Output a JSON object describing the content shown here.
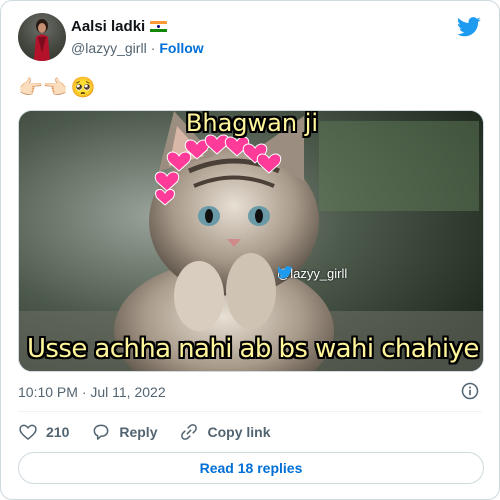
{
  "author": {
    "name": "Aalsi ladki",
    "flag_icon": "india-flag-icon",
    "handle": "@lazyy_girll",
    "separator": "·",
    "follow_label": "Follow"
  },
  "tweet": {
    "emojis": [
      "👉🏻👈🏻",
      "🥺"
    ],
    "image": {
      "caption_top": "Bhagwan ji",
      "caption_bottom": "Usse achha nahi ab bs wahi chahiye",
      "watermark": "@lazyy_girll"
    },
    "timestamp": "10:10 PM · Jul 11, 2022"
  },
  "actions": {
    "like_count": "210",
    "reply_label": "Reply",
    "copy_link_label": "Copy link"
  },
  "read_replies_label": "Read 18 replies",
  "colors": {
    "link": "#006fd6",
    "twitter_blue": "#1d9bf0",
    "muted_text": "#536471",
    "caption": "#fff59a",
    "hearts": "#ff3b9a"
  }
}
